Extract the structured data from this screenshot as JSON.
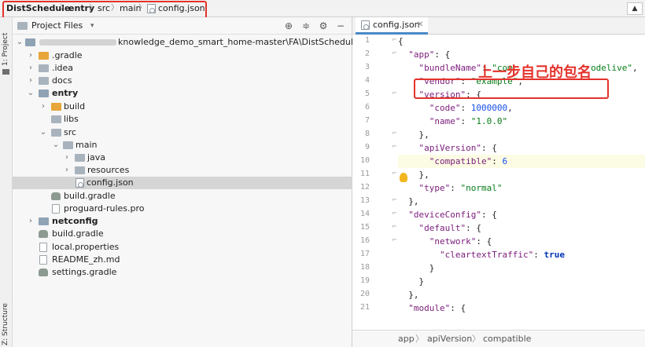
{
  "navbar": {
    "crumbs": [
      "DistSchedule",
      "entry",
      "src",
      "main",
      "config.json"
    ],
    "right_button_icon": "database-icon"
  },
  "toolstrip": {
    "project_label": "1: Project",
    "structure_label": "Z: Structure"
  },
  "project_panel": {
    "title": "Project Files",
    "header_icons": [
      "locate-icon",
      "collapse-icon",
      "settings-icon",
      "hide-icon"
    ],
    "root_path": "knowledge_demo_smart_home-master\\FA\\DistSchedule",
    "tree": [
      {
        "label": ".gradle",
        "bold": false
      },
      {
        "label": ".idea",
        "bold": false
      },
      {
        "label": "docs",
        "bold": false
      },
      {
        "label": "entry",
        "bold": true
      },
      {
        "label": "build",
        "bold": false
      },
      {
        "label": "libs",
        "bold": false
      },
      {
        "label": "src",
        "bold": false
      },
      {
        "label": "main",
        "bold": false
      },
      {
        "label": "java",
        "bold": false
      },
      {
        "label": "resources",
        "bold": false
      },
      {
        "label": "config.json",
        "bold": false
      },
      {
        "label": "build.gradle",
        "bold": false
      },
      {
        "label": "proguard-rules.pro",
        "bold": false
      },
      {
        "label": "netconfig",
        "bold": true
      },
      {
        "label": "build.gradle",
        "bold": false
      },
      {
        "label": "local.properties",
        "bold": false
      },
      {
        "label": "README_zh.md",
        "bold": false
      },
      {
        "label": "settings.gradle",
        "bold": false
      }
    ]
  },
  "editor": {
    "tab_label": "config.json",
    "annotation": "上一步自己的包名",
    "line_numbers": [
      "1",
      "2",
      "3",
      "4",
      "5",
      "6",
      "7",
      "8",
      "9",
      "10",
      "11",
      "12",
      "13",
      "14",
      "15",
      "16",
      "17",
      "18",
      "19",
      "20",
      "21"
    ],
    "code": {
      "l1": "{",
      "l2_key": "\"app\"",
      "l2_rest": ": {",
      "l3_key": "\"bundleName\"",
      "l3_colon": ": ",
      "l3_val": "\"com.         .    odelive\"",
      "l3_end": ",",
      "l4_key": "\"vendor\"",
      "l4_colon": ": ",
      "l4_val": "\"example\"",
      "l4_end": ",",
      "l5_key": "\"version\"",
      "l5_rest": ": {",
      "l6_key": "\"code\"",
      "l6_colon": ": ",
      "l6_val": "1000000",
      "l6_end": ",",
      "l7_key": "\"name\"",
      "l7_colon": ": ",
      "l7_val": "\"1.0.0\"",
      "l8": "},",
      "l9_key": "\"apiVersion\"",
      "l9_rest": ": {",
      "l10_key": "\"compatible\"",
      "l10_colon": ": ",
      "l10_val": "6",
      "l11": "},",
      "l12_key": "\"type\"",
      "l12_colon": ": ",
      "l12_val": "\"normal\"",
      "l13": "},",
      "l14_key": "\"deviceConfig\"",
      "l14_rest": ": {",
      "l15_key": "\"default\"",
      "l15_rest": ": {",
      "l16_key": "\"network\"",
      "l16_rest": ": {",
      "l17_key": "\"cleartextTraffic\"",
      "l17_colon": ": ",
      "l17_val": "true",
      "l18": "}",
      "l19": "}",
      "l20": "},",
      "l21_key": "\"module\"",
      "l21_rest": ": {"
    }
  },
  "statusbar": {
    "crumbs": [
      "app",
      "apiVersion",
      "compatible"
    ]
  }
}
